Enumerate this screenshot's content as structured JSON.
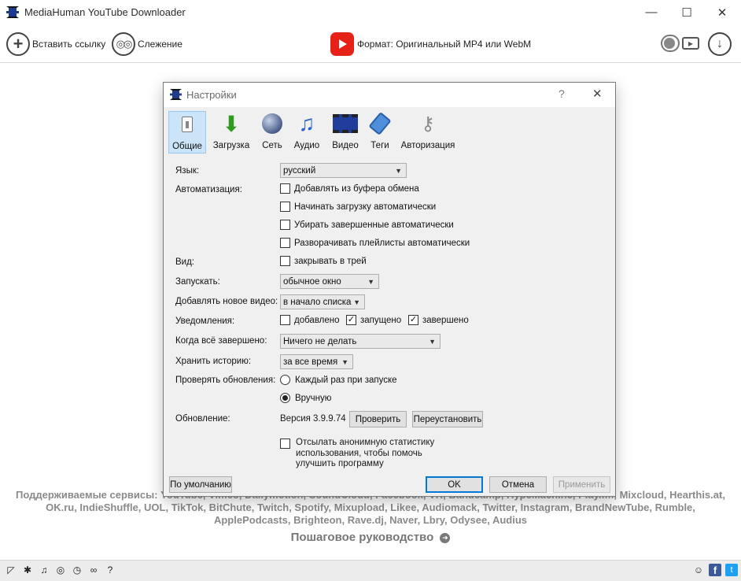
{
  "app": {
    "title": "MediaHuman YouTube Downloader",
    "window_controls": {
      "minimize": "—",
      "maximize": "☐",
      "close": "✕"
    }
  },
  "toolbar": {
    "paste_link_label": "Вставить ссылку",
    "tracking_label": "Слежение",
    "format_label": "Формат: Оригинальный MP4 или WebM"
  },
  "main": {
    "supported_text": "Поддерживаемые сервисы: YouTube, Vimeo, Dailymotion, SoundCloud, Facebook, VK, Bandcamp, HypeMachine, Play.fm, Mixcloud, Hearthis.at, OK.ru, IndieShuffle, UOL, TikTok, BitChute, Twitch, Spotify, Mixupload, Likee, Audiomack, Twitter, Instagram, BrandNewTube, Rumble, ApplePodcasts, Brighteon, Rave.dj, Naver, Lbry, Odysee, Audius",
    "guide_label": "Пошаговое руководство"
  },
  "dialog": {
    "title": "Настройки",
    "help": "?",
    "close": "✕",
    "tabs": [
      {
        "label": "Общие",
        "icon": "switch-icon",
        "active": true
      },
      {
        "label": "Загрузка",
        "icon": "download-arrow-icon"
      },
      {
        "label": "Сеть",
        "icon": "globe-icon"
      },
      {
        "label": "Аудио",
        "icon": "music-note-icon"
      },
      {
        "label": "Видео",
        "icon": "film-icon"
      },
      {
        "label": "Теги",
        "icon": "tag-icon"
      },
      {
        "label": "Авторизация",
        "icon": "keys-icon"
      }
    ],
    "language": {
      "label": "Язык:",
      "value": "русский"
    },
    "automation": {
      "label": "Автоматизация:",
      "options": [
        {
          "text": "Добавлять из буфера обмена",
          "checked": false
        },
        {
          "text": "Начинать загрузку автоматически",
          "checked": false
        },
        {
          "text": "Убирать завершенные автоматически",
          "checked": false
        },
        {
          "text": "Разворачивать плейлисты автоматически",
          "checked": false
        }
      ]
    },
    "view": {
      "label": "Вид:",
      "option": "закрывать в трей",
      "checked": false
    },
    "launch": {
      "label": "Запускать:",
      "value": "обычное окно"
    },
    "add_new": {
      "label": "Добавлять новое видео:",
      "value": "в начало списка"
    },
    "notifications": {
      "label": "Уведомления:",
      "added": {
        "text": "добавлено",
        "checked": false
      },
      "started": {
        "text": "запущено",
        "checked": true
      },
      "finished": {
        "text": "завершено",
        "checked": true
      }
    },
    "when_done": {
      "label": "Когда всё завершено:",
      "value": "Ничего не делать"
    },
    "history": {
      "label": "Хранить историю:",
      "value": "за все время"
    },
    "updates_check": {
      "label": "Проверять обновления:",
      "each_launch": "Каждый раз при запуске",
      "manual": "Вручную",
      "selected": "manual"
    },
    "update": {
      "label": "Обновление:",
      "version": "Версия 3.9.9.74",
      "check_button": "Проверить",
      "reinstall_button": "Переустановить"
    },
    "stats": {
      "line1": "Отсылать анонимную статистику",
      "line2": "использования, чтобы помочь",
      "line3": "улучшить программу",
      "checked": false
    },
    "buttons": {
      "defaults": "По умолчанию",
      "ok": "OK",
      "cancel": "Отмена",
      "apply": "Применить"
    }
  },
  "statusbar": {
    "social": {
      "facebook": "f",
      "twitter": "t"
    }
  },
  "colors": {
    "youtube_red": "#e62117",
    "tab_active_bg": "#cce4f7",
    "default_button_border": "#0078d7",
    "facebook": "#3b5998",
    "twitter": "#1da1f2"
  }
}
